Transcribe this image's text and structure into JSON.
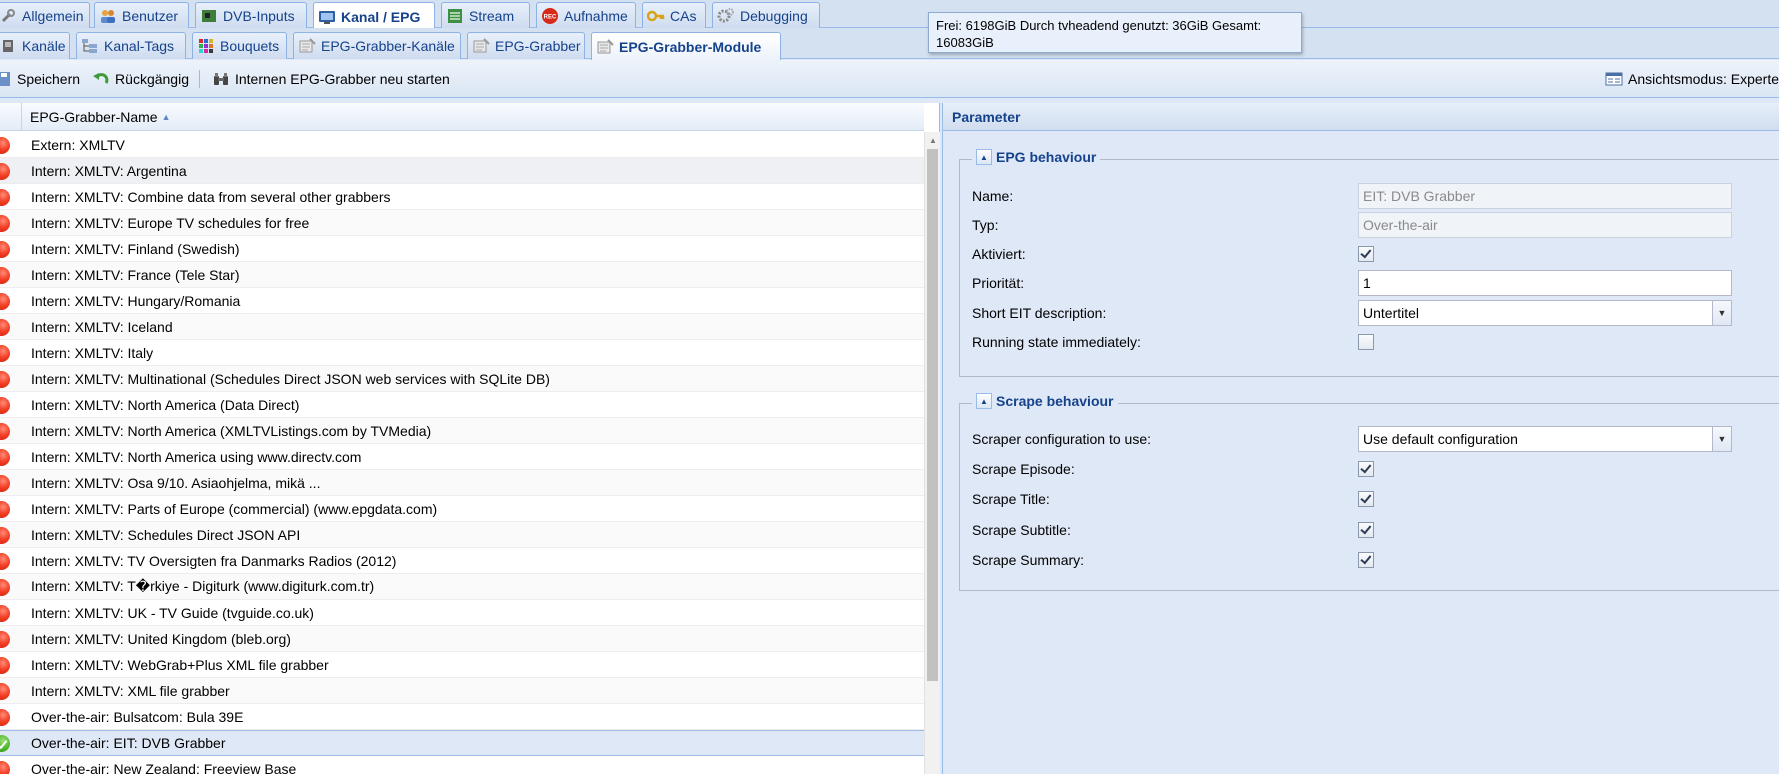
{
  "main_tabs": [
    {
      "label": "Allgemein",
      "icon": "wrench-icon"
    },
    {
      "label": "Benutzer",
      "icon": "users-icon"
    },
    {
      "label": "DVB-Inputs",
      "icon": "card-icon"
    },
    {
      "label": "Kanal / EPG",
      "icon": "tv-icon",
      "active": true
    },
    {
      "label": "Stream",
      "icon": "stream-icon"
    },
    {
      "label": "Aufnahme",
      "icon": "record-icon"
    },
    {
      "label": "CAs",
      "icon": "key-icon"
    },
    {
      "label": "Debugging",
      "icon": "gears-icon"
    }
  ],
  "sub_tabs": [
    {
      "label": "Kanäle",
      "icon": "tv-small-icon"
    },
    {
      "label": "Kanal-Tags",
      "icon": "tree-icon"
    },
    {
      "label": "Bouquets",
      "icon": "grid-color-icon"
    },
    {
      "label": "EPG-Grabber-Kanäle",
      "icon": "epg-icon"
    },
    {
      "label": "EPG-Grabber",
      "icon": "epg-icon"
    },
    {
      "label": "EPG-Grabber-Module",
      "icon": "epg-icon",
      "active": true
    }
  ],
  "tooltip": {
    "text": "Frei: 6198GiB Durch tvheadend genutzt: 36GiB Gesamt: 16083GiB"
  },
  "toolbar": {
    "save_label": "Speichern",
    "undo_label": "Rückgängig",
    "restart_label": "Internen EPG-Grabber neu starten",
    "viewmode_label": "Ansichtsmodus: Experte"
  },
  "grid": {
    "column_header": "EPG-Grabber-Name",
    "rows": [
      {
        "name": "Extern: XMLTV",
        "status": "error"
      },
      {
        "name": "Intern: XMLTV: Argentina",
        "status": "error"
      },
      {
        "name": "Intern: XMLTV: Combine data from several other grabbers",
        "status": "error"
      },
      {
        "name": "Intern: XMLTV: Europe TV schedules for free",
        "status": "error"
      },
      {
        "name": "Intern: XMLTV: Finland (Swedish)",
        "status": "error"
      },
      {
        "name": "Intern: XMLTV: France (Tele Star)",
        "status": "error"
      },
      {
        "name": "Intern: XMLTV: Hungary/Romania",
        "status": "error"
      },
      {
        "name": "Intern: XMLTV: Iceland",
        "status": "error"
      },
      {
        "name": "Intern: XMLTV: Italy",
        "status": "error"
      },
      {
        "name": "Intern: XMLTV: Multinational (Schedules Direct JSON web services with SQLite DB)",
        "status": "error"
      },
      {
        "name": "Intern: XMLTV: North America (Data Direct)",
        "status": "error"
      },
      {
        "name": "Intern: XMLTV: North America (XMLTVListings.com by TVMedia)",
        "status": "error"
      },
      {
        "name": "Intern: XMLTV: North America using www.directv.com",
        "status": "error"
      },
      {
        "name": "Intern: XMLTV: Osa 9/10. Asiaohjelma, mikä ...",
        "status": "error"
      },
      {
        "name": "Intern: XMLTV: Parts of Europe (commercial) (www.epgdata.com)",
        "status": "error"
      },
      {
        "name": "Intern: XMLTV: Schedules Direct JSON API",
        "status": "error"
      },
      {
        "name": "Intern: XMLTV: TV Oversigten fra Danmarks Radios (2012)",
        "status": "error"
      },
      {
        "name": "Intern: XMLTV: T�rkiye - Digiturk (www.digiturk.com.tr)",
        "status": "error"
      },
      {
        "name": "Intern: XMLTV: UK - TV Guide (tvguide.co.uk)",
        "status": "error"
      },
      {
        "name": "Intern: XMLTV: United Kingdom (bleb.org)",
        "status": "error"
      },
      {
        "name": "Intern: XMLTV: WebGrab+Plus XML file grabber",
        "status": "error"
      },
      {
        "name": "Intern: XMLTV: XML file grabber",
        "status": "error"
      },
      {
        "name": "Over-the-air: Bulsatcom: Bula 39E",
        "status": "error"
      },
      {
        "name": "Over-the-air: EIT: DVB Grabber",
        "status": "ok",
        "selected": true
      },
      {
        "name": "Over-the-air: New Zealand: Freeview Base",
        "status": "error"
      }
    ]
  },
  "panel": {
    "title": "Parameter",
    "epg": {
      "legend": "EPG behaviour",
      "name_label": "Name:",
      "name_value": "EIT: DVB Grabber",
      "type_label": "Typ:",
      "type_value": "Over-the-air",
      "enabled_label": "Aktiviert:",
      "enabled": true,
      "priority_label": "Priorität:",
      "priority_value": "1",
      "short_eit_label": "Short EIT description:",
      "short_eit_value": "Untertitel",
      "running_label": "Running state immediately:",
      "running": false
    },
    "scrape": {
      "legend": "Scrape behaviour",
      "config_label": "Scraper configuration to use:",
      "config_value": "Use default configuration",
      "episode_label": "Scrape Episode:",
      "episode": true,
      "title_label": "Scrape Title:",
      "title": true,
      "subtitle_label": "Scrape Subtitle:",
      "subtitle": true,
      "summary_label": "Scrape Summary:",
      "summary": true
    }
  }
}
